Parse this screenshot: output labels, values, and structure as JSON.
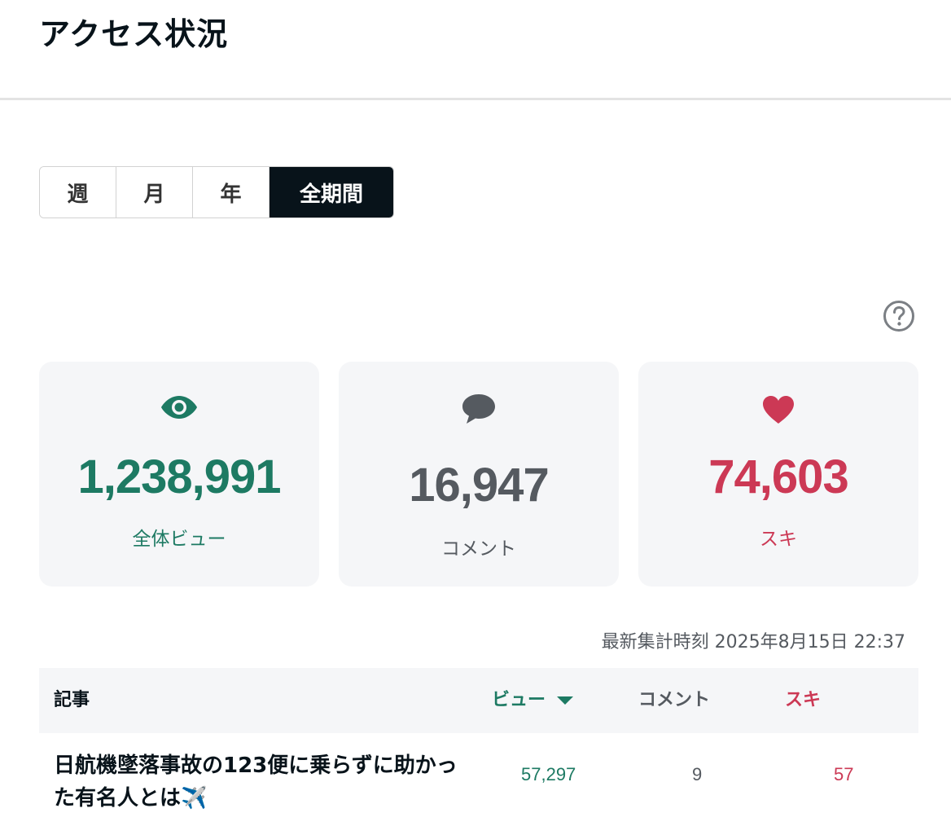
{
  "page": {
    "title": "アクセス状況"
  },
  "period_tabs": [
    {
      "label": "週",
      "active": false
    },
    {
      "label": "月",
      "active": false
    },
    {
      "label": "年",
      "active": false
    },
    {
      "label": "全期間",
      "active": true
    }
  ],
  "stats": {
    "views": {
      "value": "1,238,991",
      "label": "全体ビュー",
      "icon": "eye-icon",
      "color": "#1d7a63"
    },
    "comments": {
      "value": "16,947",
      "label": "コメント",
      "icon": "speech-bubble-icon",
      "color": "#555a60"
    },
    "likes": {
      "value": "74,603",
      "label": "スキ",
      "icon": "heart-icon",
      "color": "#cc3955"
    }
  },
  "updated_at": "最新集計時刻 2025年8月15日 22:37",
  "table": {
    "headers": {
      "article": "記事",
      "views": "ビュー",
      "comments": "コメント",
      "likes": "スキ"
    },
    "sort": {
      "column": "views",
      "direction": "desc"
    },
    "rows": [
      {
        "title": "日航機墜落事故の123便に乗らずに助かった有名人とは",
        "emoji": "✈️",
        "views": "57,297",
        "comments": "9",
        "likes": "57"
      }
    ]
  }
}
